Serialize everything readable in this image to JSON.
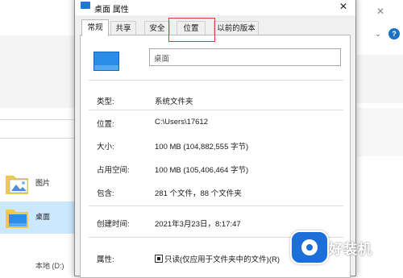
{
  "background_explorer": {
    "nav_items": [
      {
        "label": "图片",
        "icon": "pictures-folder-icon"
      },
      {
        "label": "桌面",
        "icon": "desktop-folder-icon",
        "selected": true
      }
    ],
    "cut_off_item_label": "本地 (D:)",
    "close_glyph": "✕",
    "chevron_glyph": "⌄",
    "help_glyph": "?"
  },
  "dialog": {
    "title": "桌面 属性",
    "close_glyph": "✕",
    "tabs": [
      {
        "label": "常规",
        "active": true
      },
      {
        "label": "共享",
        "active": false
      },
      {
        "label": "安全",
        "active": false
      },
      {
        "label": "位置",
        "active": false,
        "highlighted": true
      },
      {
        "label": "以前的版本",
        "active": false
      }
    ],
    "highlight_color": "#e23a3a",
    "name_value": "桌面",
    "properties": [
      {
        "label": "类型:",
        "value": "系统文件夹"
      },
      {
        "label": "位置:",
        "value": "C:\\Users\\17612"
      },
      {
        "label": "大小:",
        "value": "100 MB (104,882,555 字节)"
      },
      {
        "label": "占用空间:",
        "value": "100 MB (105,406,464 字节)"
      },
      {
        "label": "包含:",
        "value": "281 个文件，88 个文件夹"
      },
      {
        "label": "创建时间:",
        "value": "2021年3月23日，8:17:47"
      }
    ],
    "attributes_label": "属性:",
    "readonly_label": "只读(仅应用于文件夹中的文件)(R)"
  },
  "watermark": {
    "text": "好装机"
  },
  "colors": {
    "accent_blue": "#1e78d4",
    "selection": "#cce8ff",
    "dialog_bg": "#f0f0f0"
  }
}
